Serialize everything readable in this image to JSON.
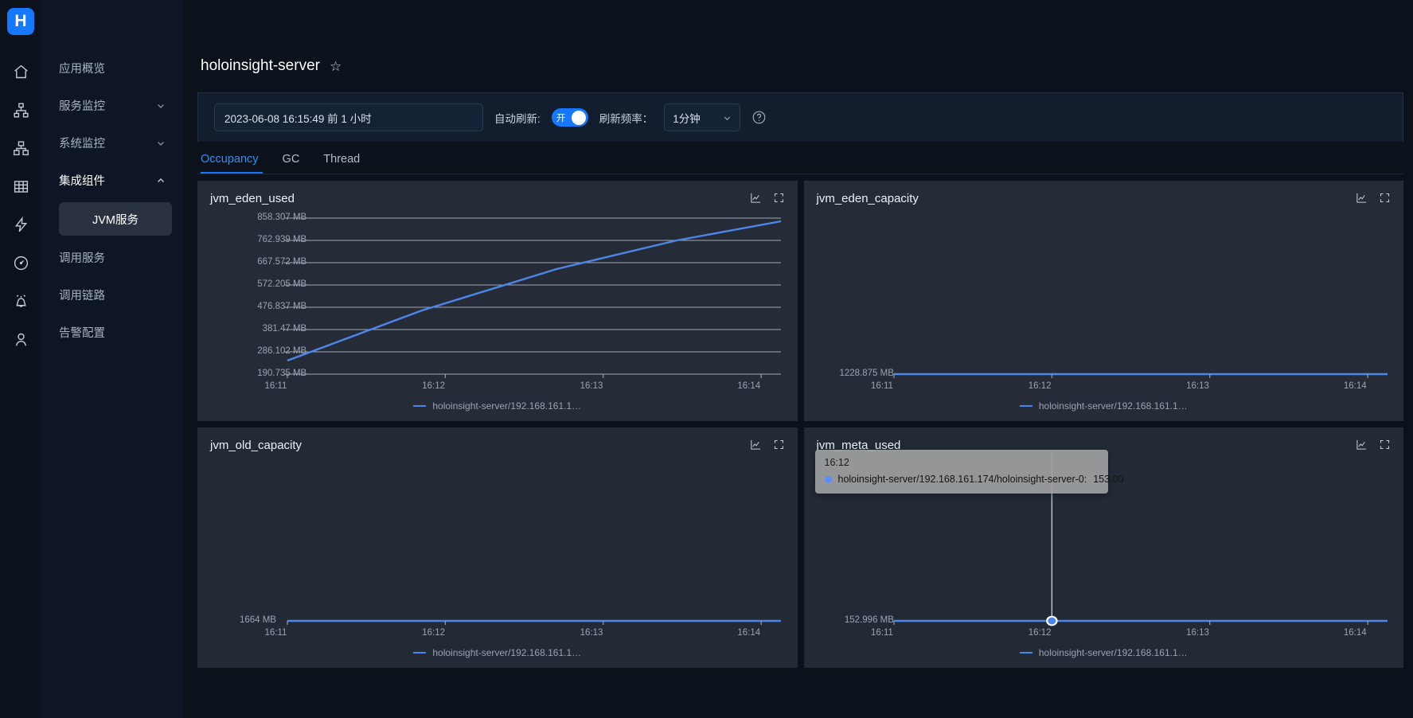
{
  "brand": {
    "logo_letter": "H",
    "accent": "#1677ff"
  },
  "rail": {
    "items": [
      {
        "name": "home-icon",
        "label": "home"
      },
      {
        "name": "topology-icon",
        "label": "topology"
      },
      {
        "name": "cluster-icon",
        "label": "cluster"
      },
      {
        "name": "table-icon",
        "label": "table"
      },
      {
        "name": "bolt-icon",
        "label": "bolt"
      },
      {
        "name": "dashboard-icon",
        "label": "dashboard"
      },
      {
        "name": "alarm-icon",
        "label": "alarm"
      },
      {
        "name": "user-icon",
        "label": "user"
      }
    ]
  },
  "nav": {
    "items": [
      {
        "label": "应用概览",
        "expandable": false,
        "expanded": false,
        "active": false
      },
      {
        "label": "服务监控",
        "expandable": true,
        "expanded": false,
        "active": false
      },
      {
        "label": "系统监控",
        "expandable": true,
        "expanded": false,
        "active": false
      },
      {
        "label": "集成组件",
        "expandable": true,
        "expanded": true,
        "active": true
      }
    ],
    "sub_item": "JVM服务",
    "items_after": [
      {
        "label": "调用服务"
      },
      {
        "label": "调用链路"
      },
      {
        "label": "告警配置"
      }
    ]
  },
  "header": {
    "title": "holoinsight-server",
    "favorite_icon": "☆"
  },
  "toolbar": {
    "date_range": "2023-06-08 16:15:49  前 1 小时",
    "auto_refresh_label": "自动刷新:",
    "auto_refresh_state": "开",
    "refresh_rate_label": "刷新频率：",
    "refresh_rate_value": "1分钟",
    "help_icon": "?"
  },
  "tabs": [
    {
      "label": "Occupancy",
      "active": true
    },
    {
      "label": "GC",
      "active": false
    },
    {
      "label": "Thread",
      "active": false
    }
  ],
  "tooltip": {
    "time": "16:12",
    "series": "holoinsight-server/192.168.161.174/holoinsight-server-0:",
    "value": "153.00"
  },
  "chart_data": [
    {
      "type": "line",
      "title": "jvm_eden_used",
      "x": [
        "16:11",
        "16:12",
        "16:13",
        "16:14"
      ],
      "xlabel": "",
      "ylabel": "",
      "yticks": [
        "190.735 MB",
        "286.102 MB",
        "381.47 MB",
        "476.837 MB",
        "572.205 MB",
        "667.572 MB",
        "762.939 MB",
        "858.307 MB"
      ],
      "ylim": [
        190.735,
        858.307
      ],
      "grid": true,
      "legend": "holoinsight-server/192.168.161.1…",
      "legend_position": "bottom",
      "series": [
        {
          "name": "holoinsight-server/192.168.161.1…",
          "color": "#4b86e8",
          "values": [
            266,
            392,
            540,
            680,
            828
          ]
        }
      ]
    },
    {
      "type": "line",
      "title": "jvm_eden_capacity",
      "x": [
        "16:11",
        "16:12",
        "16:13",
        "16:14"
      ],
      "xlabel": "",
      "ylabel": "",
      "yticks": [
        "1228.875 MB"
      ],
      "ylim": [
        1228.875,
        1228.875
      ],
      "grid": false,
      "legend": "holoinsight-server/192.168.161.1…",
      "legend_position": "bottom",
      "series": [
        {
          "name": "holoinsight-server/192.168.161.1…",
          "color": "#4b86e8",
          "values": [
            1228.875,
            1228.875,
            1228.875,
            1228.875,
            1228.875
          ]
        }
      ]
    },
    {
      "type": "line",
      "title": "jvm_old_capacity",
      "x": [
        "16:11",
        "16:12",
        "16:13",
        "16:14"
      ],
      "xlabel": "",
      "ylabel": "",
      "yticks": [
        "1664 MB"
      ],
      "ylim": [
        1664,
        1664
      ],
      "grid": false,
      "legend": "holoinsight-server/192.168.161.1…",
      "legend_position": "bottom",
      "series": [
        {
          "name": "holoinsight-server/192.168.161.1…",
          "color": "#4b86e8",
          "values": [
            1664,
            1664,
            1664,
            1664,
            1664
          ]
        }
      ]
    },
    {
      "type": "line",
      "title": "jvm_meta_used",
      "x": [
        "16:11",
        "16:12",
        "16:13",
        "16:14"
      ],
      "xlabel": "",
      "ylabel": "",
      "yticks": [
        "152.996 MB"
      ],
      "ylim": [
        152.996,
        152.996
      ],
      "grid": false,
      "legend": "holoinsight-server/192.168.161.1…",
      "legend_position": "bottom",
      "highlight_point": {
        "x": "16:12",
        "value": "153.00"
      },
      "series": [
        {
          "name": "holoinsight-server/192.168.161.1…",
          "color": "#4b86e8",
          "values": [
            152.996,
            152.996,
            152.996,
            152.996,
            152.996
          ]
        }
      ]
    }
  ]
}
